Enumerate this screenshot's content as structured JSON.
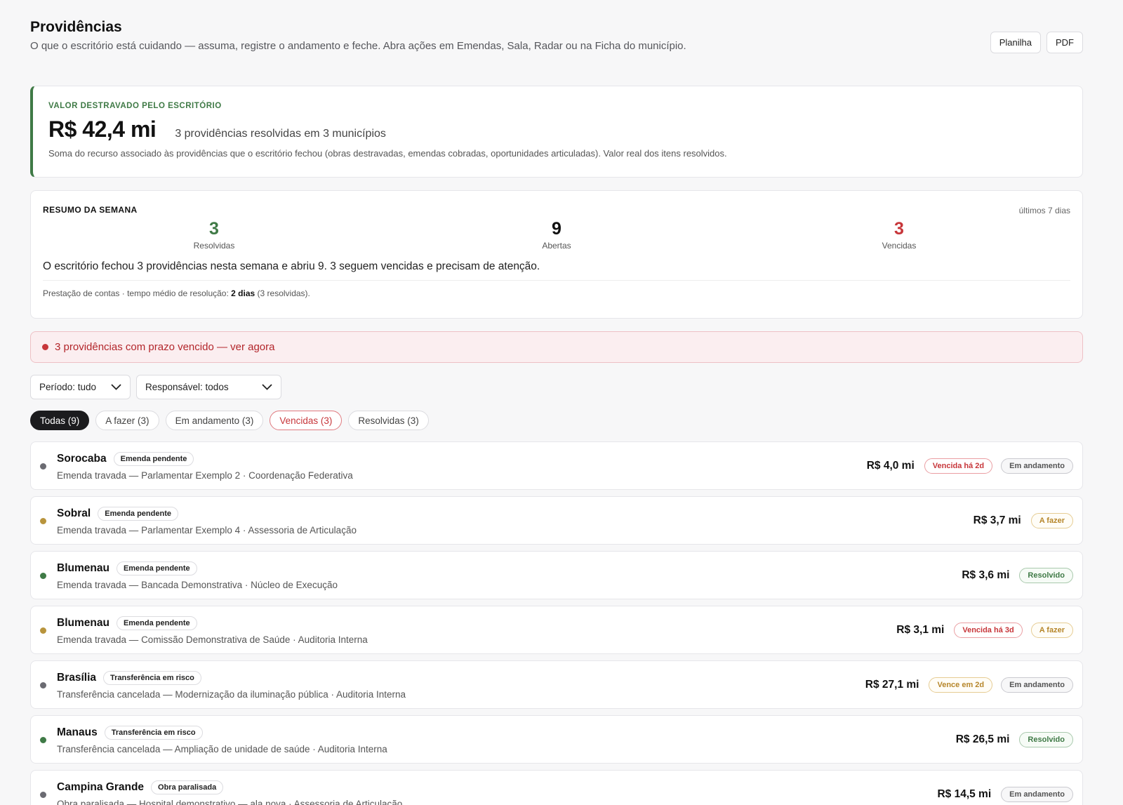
{
  "header": {
    "title": "Providências",
    "subtitle": "O que o escritório está cuidando — assuma, registre o andamento e feche. Abra ações em Emendas, Sala, Radar ou na Ficha do município.",
    "buttons": {
      "planilha": "Planilha",
      "pdf": "PDF"
    }
  },
  "valor": {
    "label": "VALOR DESTRAVADO PELO ESCRITÓRIO",
    "amount": "R$ 42,4 mi",
    "desc": "3 providências resolvidas em 3 municípios",
    "note": "Soma do recurso associado às providências que o escritório fechou (obras destravadas, emendas cobradas, oportunidades articuladas). Valor real dos itens resolvidos."
  },
  "resumo": {
    "label": "RESUMO DA SEMANA",
    "period": "últimos 7 dias",
    "stats": [
      {
        "value": "3",
        "label": "Resolvidas",
        "color": "#3f7a46"
      },
      {
        "value": "9",
        "label": "Abertas",
        "color": "#111111"
      },
      {
        "value": "3",
        "label": "Vencidas",
        "color": "#c7363a"
      }
    ],
    "text": "O escritório fechou 3 providências nesta semana e abriu 9. 3 seguem vencidas e precisam de atenção.",
    "footer_prefix": "Prestação de contas · tempo médio de resolução: ",
    "footer_bold": "2 dias",
    "footer_suffix": " (3 resolvidas)."
  },
  "alert": {
    "text": "3 providências com prazo vencido — ver agora"
  },
  "filters": {
    "periodo": "Período: tudo",
    "responsavel": "Responsável: todos"
  },
  "tabs": [
    {
      "label": "Todas (9)"
    },
    {
      "label": "A fazer (3)"
    },
    {
      "label": "Em andamento (3)"
    },
    {
      "label": "Vencidas (3)"
    },
    {
      "label": "Resolvidas (3)"
    }
  ],
  "items": [
    {
      "city": "Sorocaba",
      "tag": "Emenda pendente",
      "sub": "Emenda travada — Parlamentar Exemplo 2 · Coordenação Federativa",
      "value": "R$ 4,0 mi",
      "deadline": "Vencida há 2d",
      "status": "Em andamento",
      "dot": "#6b6b72"
    },
    {
      "city": "Sobral",
      "tag": "Emenda pendente",
      "sub": "Emenda travada — Parlamentar Exemplo 4 · Assessoria de Articulação",
      "value": "R$ 3,7 mi",
      "deadline": "",
      "status": "A fazer",
      "dot": "#b8943c"
    },
    {
      "city": "Blumenau",
      "tag": "Emenda pendente",
      "sub": "Emenda travada — Bancada Demonstrativa · Núcleo de Execução",
      "value": "R$ 3,6 mi",
      "deadline": "",
      "status": "Resolvido",
      "dot": "#3f7a46"
    },
    {
      "city": "Blumenau",
      "tag": "Emenda pendente",
      "sub": "Emenda travada — Comissão Demonstrativa de Saúde · Auditoria Interna",
      "value": "R$ 3,1 mi",
      "deadline": "Vencida há 3d",
      "status": "A fazer",
      "dot": "#b8943c"
    },
    {
      "city": "Brasília",
      "tag": "Transferência em risco",
      "sub": "Transferência cancelada — Modernização da iluminação pública · Auditoria Interna",
      "value": "R$ 27,1 mi",
      "deadline": "Vence em 2d",
      "status": "Em andamento",
      "dot": "#6b6b72"
    },
    {
      "city": "Manaus",
      "tag": "Transferência em risco",
      "sub": "Transferência cancelada — Ampliação de unidade de saúde · Auditoria Interna",
      "value": "R$ 26,5 mi",
      "deadline": "",
      "status": "Resolvido",
      "dot": "#3f7a46"
    },
    {
      "city": "Campina Grande",
      "tag": "Obra paralisada",
      "sub": "Obra paralisada — Hospital demonstrativo — ala nova · Assessoria de Articulação",
      "value": "R$ 14,5 mi",
      "deadline": "",
      "status": "Em andamento",
      "dot": "#6b6b72"
    }
  ]
}
